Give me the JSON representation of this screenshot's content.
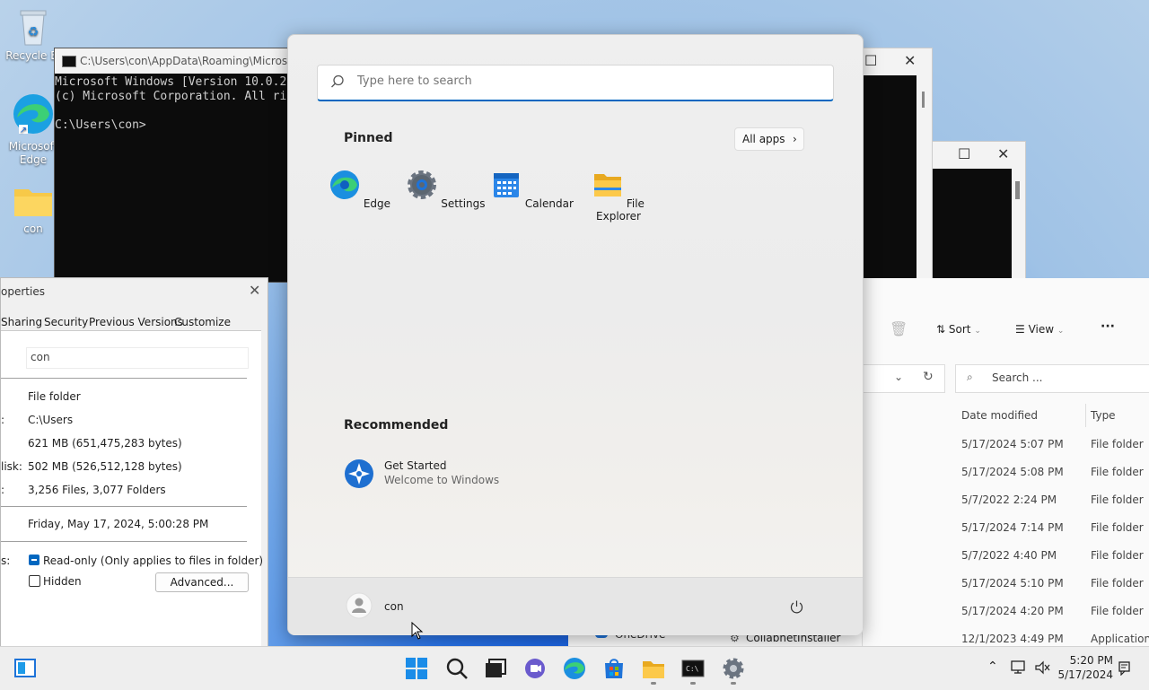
{
  "desktop": {
    "icons": [
      {
        "label": "Recycle Bi",
        "name": "recycle-bin"
      },
      {
        "label": "Microsoft Edge",
        "name": "edge"
      },
      {
        "label": "con",
        "name": "folder"
      }
    ]
  },
  "cmd": {
    "title": "C:\\Users\\con\\AppData\\Roaming\\Microsoft\\",
    "lines": [
      "Microsoft Windows [Version 10.0.2",
      "(c) Microsoft Corporation. All ri",
      "",
      "C:\\Users\\con>"
    ]
  },
  "start_menu": {
    "search_placeholder": "Type here to search",
    "pinned_label": "Pinned",
    "all_apps_label": "All apps",
    "pinned": [
      {
        "label": "Edge",
        "icon": "edge-icon"
      },
      {
        "label": "Settings",
        "icon": "gear-icon"
      },
      {
        "label": "Calendar",
        "icon": "calendar-icon"
      },
      {
        "label": "File Explorer",
        "icon": "folder-icon"
      }
    ],
    "recommended_label": "Recommended",
    "recommended": [
      {
        "title": "Get Started",
        "subtitle": "Welcome to Windows"
      }
    ],
    "user": "con"
  },
  "properties": {
    "title": "operties",
    "tabs": [
      "Sharing",
      "Security",
      "Previous Versions",
      "Customize"
    ],
    "name_value": "con",
    "fields": [
      {
        "label": "",
        "value": "File folder"
      },
      {
        "label": ":",
        "value": "C:\\Users"
      },
      {
        "label": "",
        "value": "621 MB (651,475,283 bytes)"
      },
      {
        "label": "lisk:",
        "value": "502 MB (526,512,128 bytes)"
      },
      {
        "label": ":",
        "value": "3,256 Files, 3,077 Folders"
      },
      {
        "label": "",
        "value": "Friday, May 17, 2024, 5:00:28 PM"
      }
    ],
    "attr_label": "s:",
    "readonly_label": "Read-only (Only applies to files in folder)",
    "hidden_label": "Hidden",
    "advanced_label": "Advanced..."
  },
  "explorer": {
    "sort_label": "Sort",
    "view_label": "View",
    "search_placeholder": "Search ...",
    "col_date": "Date modified",
    "col_type": "Type",
    "rows": [
      {
        "date": "5/17/2024 5:07 PM",
        "type": "File folder"
      },
      {
        "date": "5/17/2024 5:08 PM",
        "type": "File folder"
      },
      {
        "date": "5/7/2022 2:24 PM",
        "type": "File folder"
      },
      {
        "date": "5/17/2024 7:14 PM",
        "type": "File folder"
      },
      {
        "date": "5/7/2022 4:40 PM",
        "type": "File folder"
      },
      {
        "date": "5/17/2024 5:10 PM",
        "type": "File folder"
      },
      {
        "date": "5/17/2024 4:20 PM",
        "type": "File folder"
      },
      {
        "date": "12/1/2023 4:49 PM",
        "type": "Application"
      }
    ],
    "onedrive_label": "OneDrive",
    "collabnet_label": "CollabnetInstaller"
  },
  "taskbar": {
    "time": "5:20 PM",
    "date": "5/17/2024"
  }
}
